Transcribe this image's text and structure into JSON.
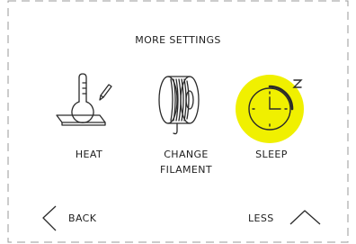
{
  "screen": {
    "title": "MORE SETTINGS"
  },
  "options": [
    {
      "id": "heat",
      "label": "HEAT",
      "icon": "heat-bed-thermometer-icon"
    },
    {
      "id": "change-filament",
      "label": "CHANGE FILAMENT",
      "icon": "filament-spool-icon"
    },
    {
      "id": "sleep",
      "label": "SLEEP",
      "icon": "sleep-clock-icon",
      "highlighted": true
    }
  ],
  "nav": {
    "back_label": "BACK",
    "back_icon": "chevron-left-icon",
    "less_label": "LESS",
    "less_icon": "chevron-up-icon"
  },
  "colors": {
    "highlight": "#f0f000",
    "line": "#2a2a2a",
    "frame": "#9a9a9a"
  }
}
